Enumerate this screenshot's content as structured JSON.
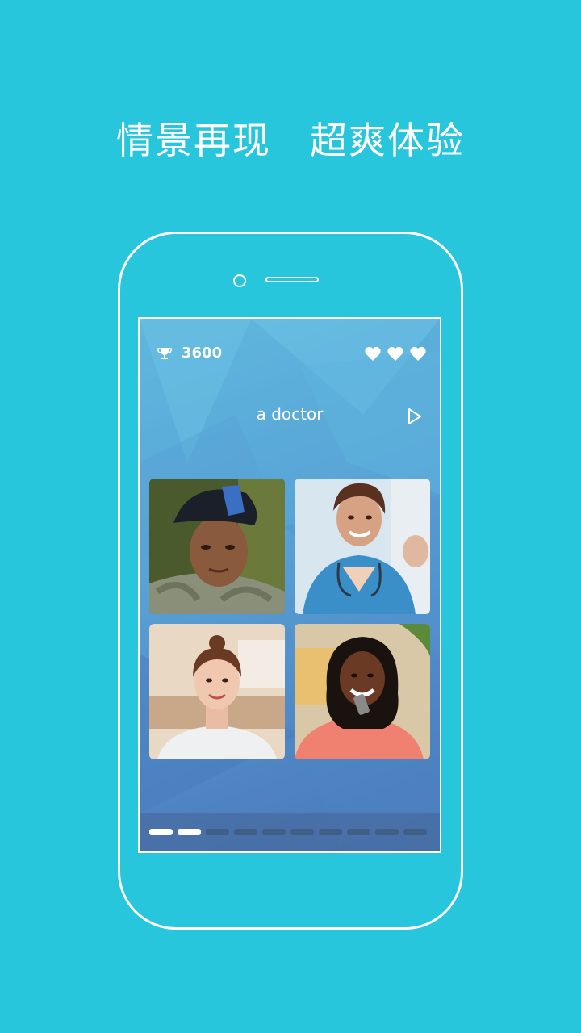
{
  "headline": {
    "left": "情景再现",
    "right": "超爽体验"
  },
  "game": {
    "score": "3600",
    "score_icon": "trophy-icon",
    "lives": 3,
    "word": "a doctor",
    "audio_icon": "play-icon"
  },
  "choices": [
    {
      "name": "photo-soldier"
    },
    {
      "name": "photo-nurse"
    },
    {
      "name": "photo-young-woman"
    },
    {
      "name": "photo-woman-on-phone"
    }
  ],
  "progress": {
    "completed": 2,
    "total": 10
  },
  "colors": {
    "background": "#27c6dc",
    "accent": "#ffffff"
  }
}
